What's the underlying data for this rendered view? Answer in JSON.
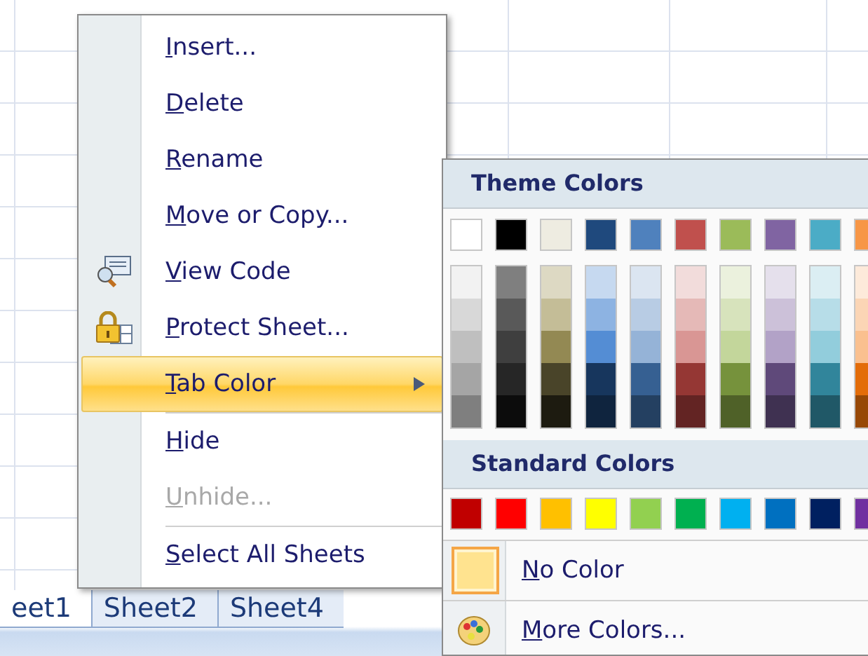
{
  "sheet_tabs": [
    {
      "label": "eet1",
      "selected": true
    },
    {
      "label": "Sheet2",
      "selected": false
    },
    {
      "label": "Sheet4",
      "selected": false
    }
  ],
  "context_menu": {
    "items": [
      {
        "label": "Insert...",
        "kind": "plain",
        "disabled": false,
        "selected": false,
        "separator_before": false
      },
      {
        "label": "Delete",
        "kind": "plain",
        "disabled": false,
        "selected": false,
        "separator_before": false
      },
      {
        "label": "Rename",
        "kind": "plain",
        "disabled": false,
        "selected": false,
        "separator_before": false
      },
      {
        "label": "Move or Copy...",
        "kind": "plain",
        "disabled": false,
        "selected": false,
        "separator_before": false
      },
      {
        "label": "View Code",
        "kind": "code",
        "disabled": false,
        "selected": false,
        "separator_before": false
      },
      {
        "label": "Protect Sheet...",
        "kind": "protect",
        "disabled": false,
        "selected": false,
        "separator_before": false
      },
      {
        "label": "Tab Color",
        "kind": "submenu",
        "disabled": false,
        "selected": true,
        "separator_before": false
      },
      {
        "label": "Hide",
        "kind": "plain",
        "disabled": false,
        "selected": false,
        "separator_before": true
      },
      {
        "label": "Unhide...",
        "kind": "plain",
        "disabled": true,
        "selected": false,
        "separator_before": false
      },
      {
        "label": "Select All Sheets",
        "kind": "plain",
        "disabled": false,
        "selected": false,
        "separator_before": true
      }
    ]
  },
  "color_submenu": {
    "theme_title": "Theme Colors",
    "theme_top": [
      {
        "color": "#ffffff"
      },
      {
        "color": "#000000"
      },
      {
        "color": "#eeece1"
      },
      {
        "color": "#1f497d"
      },
      {
        "color": "#4f81bd"
      },
      {
        "color": "#c0504d"
      },
      {
        "color": "#9bbb59"
      },
      {
        "color": "#8064a2"
      },
      {
        "color": "#4bacc6"
      },
      {
        "color": "#f79646"
      }
    ],
    "theme_shades": [
      {
        "shades": [
          {
            "color": "#f2f2f2"
          },
          {
            "color": "#d8d8d8"
          },
          {
            "color": "#bfbfbf"
          },
          {
            "color": "#a5a5a5"
          },
          {
            "color": "#7f7f7f"
          }
        ]
      },
      {
        "shades": [
          {
            "color": "#7f7f7f"
          },
          {
            "color": "#595959"
          },
          {
            "color": "#3f3f3f"
          },
          {
            "color": "#262626"
          },
          {
            "color": "#0c0c0c"
          }
        ]
      },
      {
        "shades": [
          {
            "color": "#ddd9c3"
          },
          {
            "color": "#c4bd97"
          },
          {
            "color": "#938953"
          },
          {
            "color": "#494429"
          },
          {
            "color": "#1d1b10"
          }
        ]
      },
      {
        "shades": [
          {
            "color": "#c6d9f0"
          },
          {
            "color": "#8db3e2"
          },
          {
            "color": "#548dd4"
          },
          {
            "color": "#17365d"
          },
          {
            "color": "#0f243e"
          }
        ]
      },
      {
        "shades": [
          {
            "color": "#dbe5f1"
          },
          {
            "color": "#b8cce4"
          },
          {
            "color": "#95b3d7"
          },
          {
            "color": "#366092"
          },
          {
            "color": "#244061"
          }
        ]
      },
      {
        "shades": [
          {
            "color": "#f2dcdb"
          },
          {
            "color": "#e5b9b7"
          },
          {
            "color": "#d99694"
          },
          {
            "color": "#953734"
          },
          {
            "color": "#632423"
          }
        ]
      },
      {
        "shades": [
          {
            "color": "#ebf1dd"
          },
          {
            "color": "#d7e3bc"
          },
          {
            "color": "#c3d69b"
          },
          {
            "color": "#76923c"
          },
          {
            "color": "#4f6128"
          }
        ]
      },
      {
        "shades": [
          {
            "color": "#e5e0ec"
          },
          {
            "color": "#ccc1d9"
          },
          {
            "color": "#b2a2c7"
          },
          {
            "color": "#5f497a"
          },
          {
            "color": "#3f3151"
          }
        ]
      },
      {
        "shades": [
          {
            "color": "#dbeef3"
          },
          {
            "color": "#b7dde8"
          },
          {
            "color": "#92cddc"
          },
          {
            "color": "#31859b"
          },
          {
            "color": "#205867"
          }
        ]
      },
      {
        "shades": [
          {
            "color": "#fdeada"
          },
          {
            "color": "#fbd5b5"
          },
          {
            "color": "#fac08f"
          },
          {
            "color": "#e36c09"
          },
          {
            "color": "#974806"
          }
        ]
      }
    ],
    "standard_title": "Standard Colors",
    "standard": [
      {
        "color": "#c00000"
      },
      {
        "color": "#ff0000"
      },
      {
        "color": "#ffc000"
      },
      {
        "color": "#ffff00"
      },
      {
        "color": "#92d050"
      },
      {
        "color": "#00b050"
      },
      {
        "color": "#00b0f0"
      },
      {
        "color": "#0070c0"
      },
      {
        "color": "#002060"
      },
      {
        "color": "#7030a0"
      }
    ],
    "no_color": {
      "label": "No Color",
      "selected": true
    },
    "more_colors": {
      "label": "More Colors..."
    }
  }
}
